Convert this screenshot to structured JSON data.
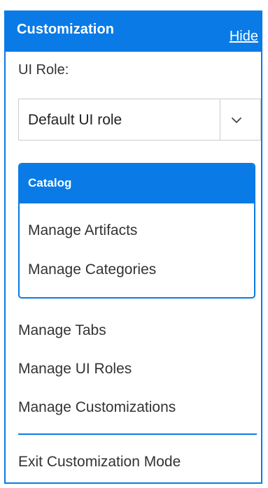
{
  "panel": {
    "title": "Customization",
    "hide_label": "Hide"
  },
  "role": {
    "label": "UI Role:",
    "selected": "Default UI role"
  },
  "catalog": {
    "title": "Catalog",
    "items": [
      {
        "label": "Manage Artifacts"
      },
      {
        "label": "Manage Categories"
      }
    ]
  },
  "menu": {
    "items": [
      {
        "label": "Manage Tabs"
      },
      {
        "label": "Manage UI Roles"
      },
      {
        "label": "Manage Customizations"
      }
    ],
    "exit_label": "Exit Customization Mode"
  },
  "colors": {
    "accent": "#0a7be6",
    "text": "#333333",
    "border": "#cccccc"
  },
  "icons": {
    "dropdown": "chevron-down-icon"
  }
}
